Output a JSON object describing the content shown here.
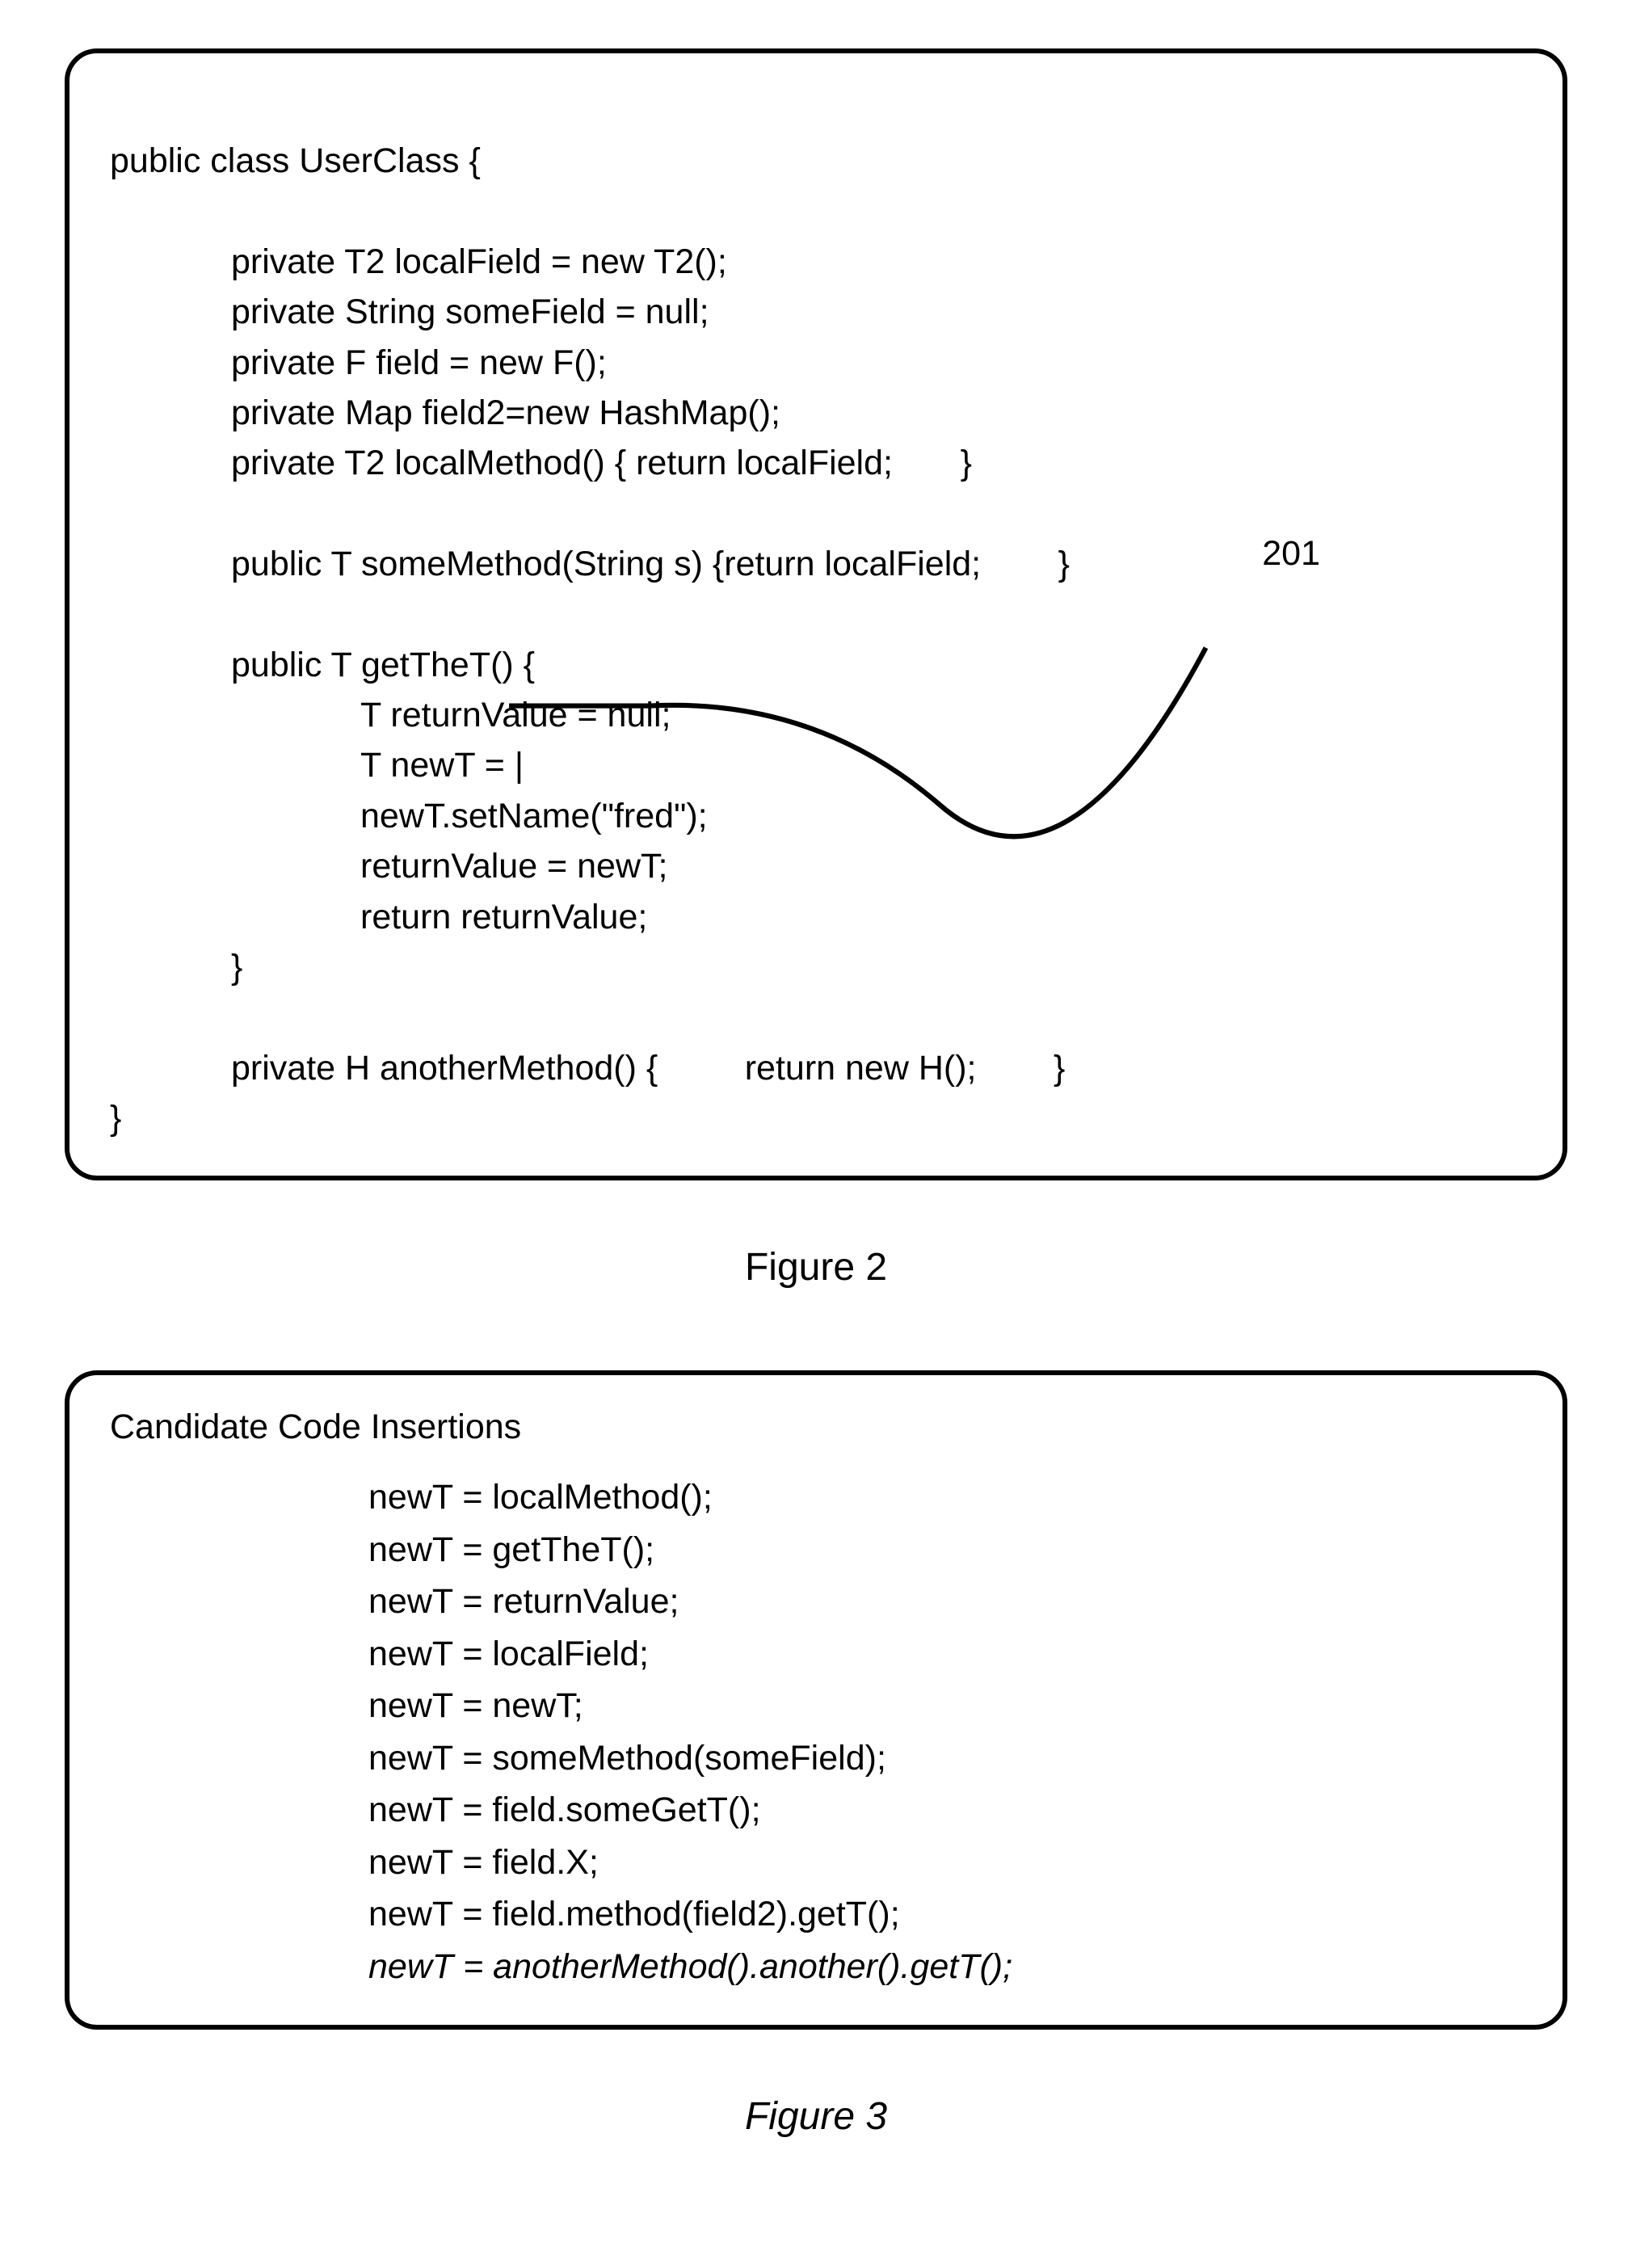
{
  "panel1": {
    "line1": "public class UserClass {",
    "block1": {
      "l1": "private T2 localField = new T2();",
      "l2": "private String someField = null;",
      "l3": "private F field = new F();",
      "l4": "private Map field2=new HashMap();",
      "l5": "private T2 localMethod() { return localField;       }"
    },
    "line6": "public T someMethod(String s) {return localField;        }",
    "line7": "public T getTheT() {",
    "block2": {
      "l1": "T returnValue = null;",
      "l2": "T newT = |",
      "l3": "newT.setName(\"fred\");",
      "l4": "returnValue = newT;",
      "l5": "return returnValue;"
    },
    "line13": "}",
    "line14": "private H anotherMethod() {         return new H();        }",
    "line15": "}",
    "ref": "201"
  },
  "figure2": "Figure 2",
  "panel2": {
    "title": "Candidate Code Insertions",
    "items": [
      "newT = localMethod();",
      "newT = getTheT();",
      "newT = returnValue;",
      "newT = localField;",
      "newT = newT;",
      "newT = someMethod(someField);",
      "newT = field.someGetT();",
      "newT = field.X;",
      "newT = field.method(field2).getT();",
      "newT = anotherMethod().another().getT();"
    ]
  },
  "figure3": "Figure 3"
}
